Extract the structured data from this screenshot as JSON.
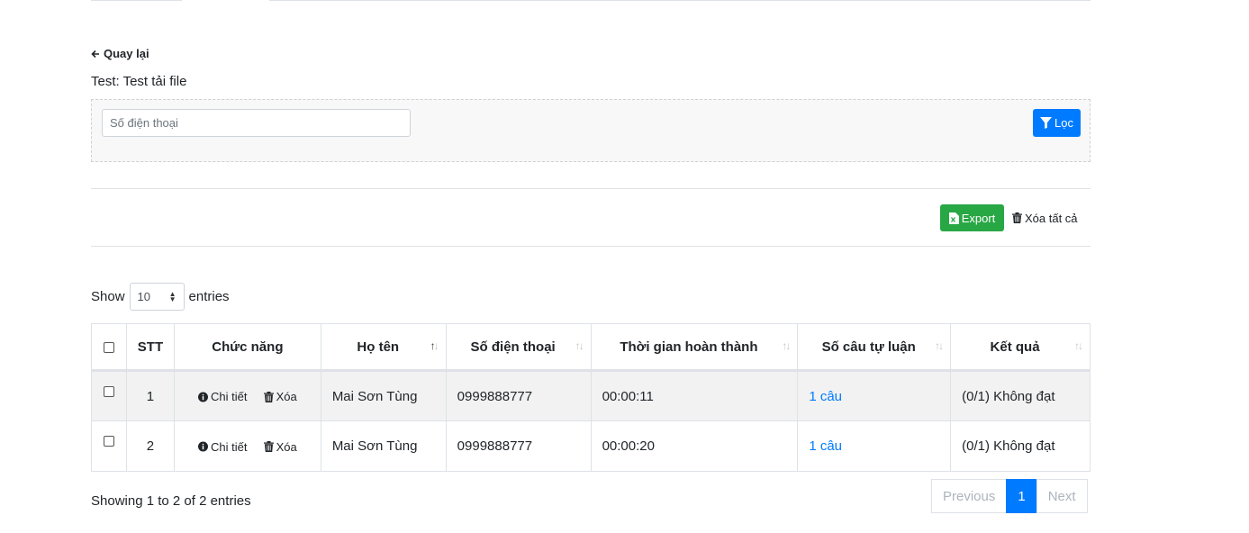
{
  "header": {
    "back_label": "Quay lại",
    "test_title": "Test: Test tải file"
  },
  "filter": {
    "phone_placeholder": "Số điện thoại",
    "filter_button": "Lọc"
  },
  "actions": {
    "export_label": "Export",
    "delete_all_label": "Xóa tất cả"
  },
  "length": {
    "show_label": "Show",
    "value": "10",
    "entries_label": "entries"
  },
  "table": {
    "columns": [
      "",
      "STT",
      "Chức năng",
      "Họ tên",
      "Số điện thoại",
      "Thời gian hoàn thành",
      "Số câu tự luận",
      "Kết quả"
    ],
    "action_labels": {
      "detail": "Chi tiết",
      "delete": "Xóa"
    },
    "rows": [
      {
        "stt": "1",
        "name": "Mai Sơn Tùng",
        "phone": "0999888777",
        "time": "00:00:11",
        "essays": "1 câu",
        "result": "(0/1) Không đạt"
      },
      {
        "stt": "2",
        "name": "Mai Sơn Tùng",
        "phone": "0999888777",
        "time": "00:00:20",
        "essays": "1 câu",
        "result": "(0/1) Không đạt"
      }
    ]
  },
  "footer": {
    "info": "Showing 1 to 2 of 2 entries",
    "previous": "Previous",
    "page": "1",
    "next": "Next"
  },
  "colors": {
    "primary": "#007bff",
    "success": "#28a745"
  }
}
